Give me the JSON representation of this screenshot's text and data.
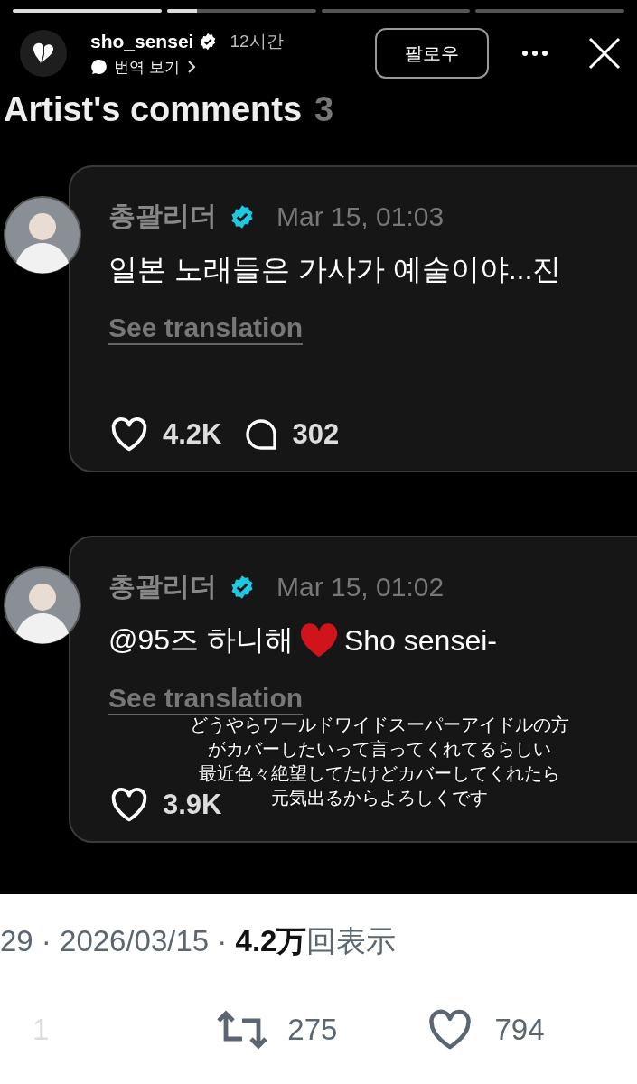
{
  "story": {
    "progress": [
      {
        "level": 1
      },
      {
        "level": 0.2
      },
      {
        "level": 0
      },
      {
        "level": 0
      }
    ],
    "username": "sho_sensei",
    "verified": true,
    "time": "12시간",
    "translate_link": "번역 보기",
    "follow_button": "팔로우"
  },
  "post": {
    "title": "Artist's comments",
    "count": "3",
    "comments": [
      {
        "author": "총괄리더",
        "verified": true,
        "date": "Mar 15, 01:03",
        "body": [
          {
            "kind": "text",
            "text": "일본 노래들은 가사가 예술이야...진"
          }
        ],
        "see_translation": "See translation",
        "likes": "4.2K",
        "replies": "302"
      },
      {
        "author": "총괄리더",
        "verified": true,
        "date": "Mar 15, 01:02",
        "body": [
          {
            "kind": "text",
            "text": "@95즈 하니해"
          },
          {
            "kind": "heart"
          },
          {
            "kind": "text",
            "text": "Sho sensei-"
          }
        ],
        "see_translation": "See translation",
        "likes": "3.9K"
      }
    ]
  },
  "caption": [
    "どうやらワールドワイドスーパーアイドルの方",
    "がカバーしたいって言ってくれてるらしい",
    "最近色々絶望してたけどカバーしてくれたら",
    "元気出るからよろしくです"
  ],
  "tweet_footer": {
    "meta": "29 · 2026/03/15 · **4.2万**回表示",
    "replies": "1",
    "retweets": "275",
    "likes": "794"
  }
}
